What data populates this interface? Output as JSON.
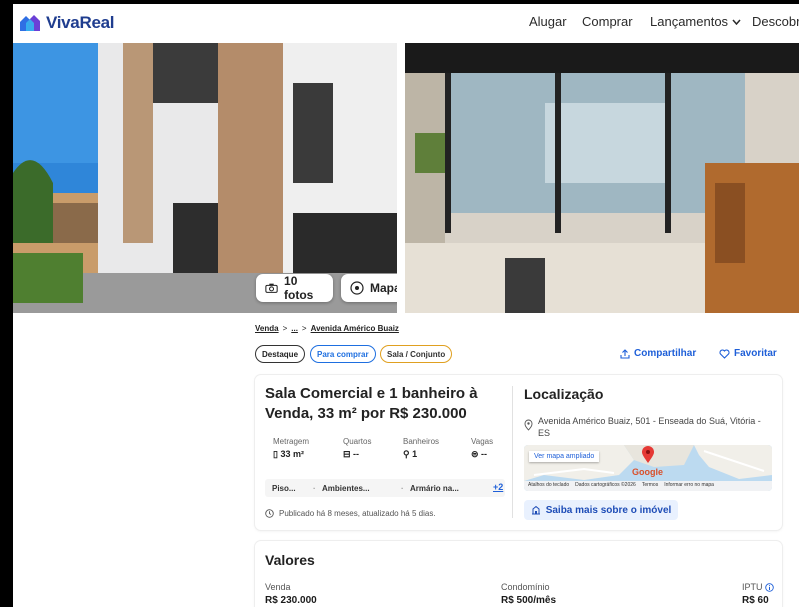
{
  "brand": {
    "name": "VivaReal"
  },
  "nav": {
    "alugar": "Alugar",
    "comprar": "Comprar",
    "lancamentos": "Lançamentos",
    "descobrir": "Descobri"
  },
  "gallery": {
    "fotos_label": "10 fotos",
    "mapa_label": "Mapa"
  },
  "breadcrumb": {
    "venda": "Venda",
    "sep": ">",
    "ellipsis": "...",
    "street": "Avenida Américo Buaiz"
  },
  "tags": [
    "Destaque",
    "Para comprar",
    "Sala / Conjunto"
  ],
  "actions": {
    "share": "Compartilhar",
    "favorite": "Favoritar"
  },
  "listing": {
    "title": "Sala Comercial e 1 banheiro à Venda, 33 m² por R$ 230.000",
    "specs": [
      {
        "label": "Metragem",
        "value": "33 m²"
      },
      {
        "label": "Quartos",
        "value": "--"
      },
      {
        "label": "Banheiros",
        "value": "1"
      },
      {
        "label": "Vagas",
        "value": "--"
      }
    ],
    "amenities": [
      "Piso...",
      "Ambientes...",
      "Armário na..."
    ],
    "amenities_more": "+2",
    "published": "Publicado há 8 meses, atualizado há 5 dias."
  },
  "location": {
    "heading": "Localização",
    "address": "Avenida Américo Buaiz, 501 - Enseada do Suá, Vitória - ES",
    "map_link": "Ver mapa ampliado",
    "map_google": "Google",
    "map_footer": [
      "Atalhos do teclado",
      "Dados cartográficos ©2026",
      "Termos",
      "Informar erro no mapa"
    ],
    "more_button": "Saiba mais sobre o imóvel"
  },
  "values": {
    "heading": "Valores",
    "venda_label": "Venda",
    "venda_value": "R$ 230.000",
    "condominio_label": "Condomínio",
    "condominio_value": "R$ 500/mês",
    "iptu_label": "IPTU",
    "iptu_value": "R$ 60"
  },
  "colors": {
    "brand": "#1f3d8f",
    "accent": "#1e5fd8",
    "destaque_border": "#333333",
    "comprar_border": "#1e6fe0",
    "sala_border": "#e0a020"
  }
}
